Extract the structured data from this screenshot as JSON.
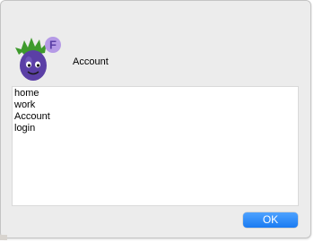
{
  "dialog": {
    "header_label": "Account",
    "icon_name": "eggplant-app-icon",
    "badge_letter": "F",
    "colors": {
      "window_bg": "#ececec",
      "list_bg": "#ffffff",
      "button_accent": "#1a7bf2",
      "eggplant_body": "#5b3fa6",
      "leaf_green": "#3e9a2c",
      "badge_bg": "#b59ae6"
    }
  },
  "list": {
    "items": [
      "home",
      "work",
      "Account",
      "login"
    ]
  },
  "buttons": {
    "ok_label": "OK"
  }
}
